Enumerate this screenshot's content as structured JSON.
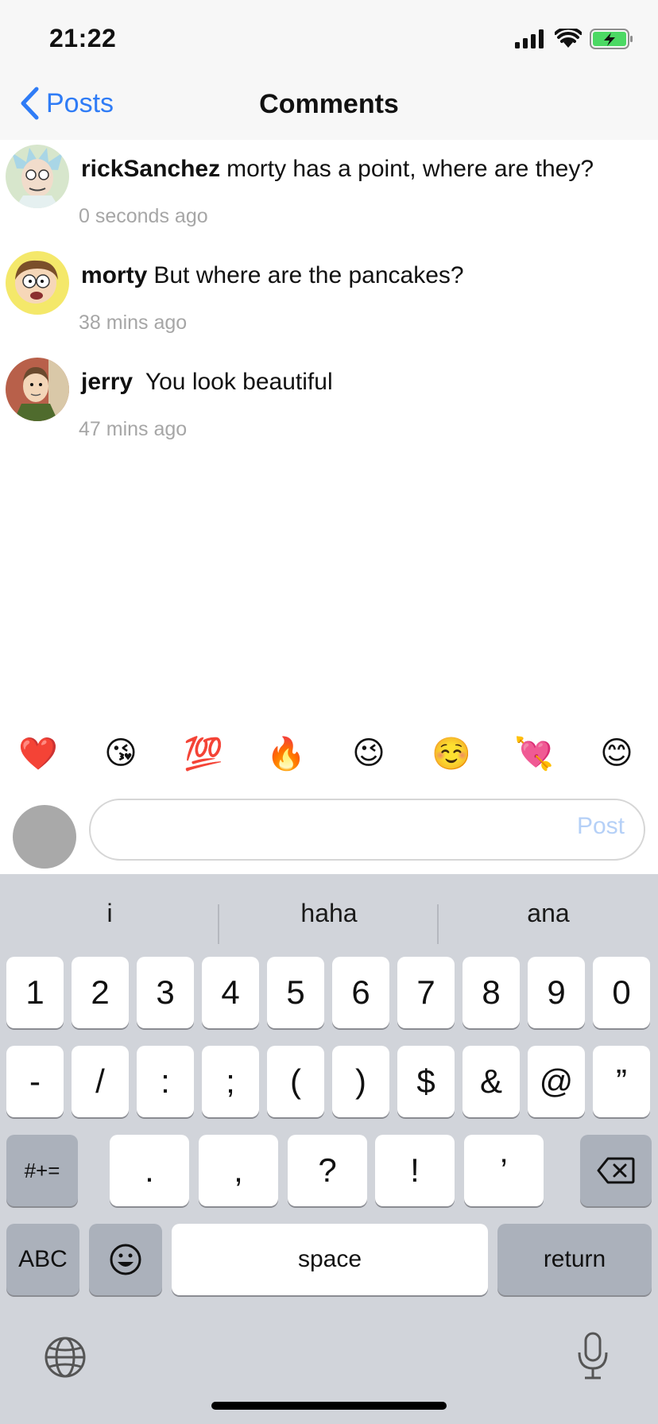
{
  "status_bar": {
    "time": "21:22",
    "icons": [
      "cellular-signal-icon",
      "wifi-icon",
      "battery-charging-icon"
    ],
    "battery_color": "#4cd964"
  },
  "nav": {
    "back_label": "Posts",
    "title": "Comments",
    "accent_color": "#2f7cf6"
  },
  "comments": [
    {
      "username": "rickSanchez",
      "text": "morty has a point, where are they?",
      "time": "0 seconds ago",
      "avatar": "rick-avatar"
    },
    {
      "username": "morty",
      "text": "But where are the pancakes?",
      "time": "38 mins ago",
      "avatar": "morty-avatar"
    },
    {
      "username": "jerry",
      "text": " You look beautiful",
      "time": "47 mins ago",
      "avatar": "jerry-avatar"
    }
  ],
  "emoji_bar": [
    "❤️",
    "😘",
    "💯",
    "🔥",
    "😉",
    "☺️",
    "💘",
    "😊"
  ],
  "comment_input": {
    "value": "",
    "placeholder": "",
    "post_label": "Post"
  },
  "keyboard": {
    "suggestions": [
      "i",
      "haha",
      "ana"
    ],
    "row1": [
      "1",
      "2",
      "3",
      "4",
      "5",
      "6",
      "7",
      "8",
      "9",
      "0"
    ],
    "row2": [
      "-",
      "/",
      ":",
      ";",
      "(",
      ")",
      "$",
      "&",
      "@",
      "”"
    ],
    "row3_symbols_key": "#+=",
    "row3": [
      ".",
      ",",
      "?",
      "!",
      "’"
    ],
    "abc_key": "ABC",
    "space_key": "space",
    "return_key": "return"
  }
}
